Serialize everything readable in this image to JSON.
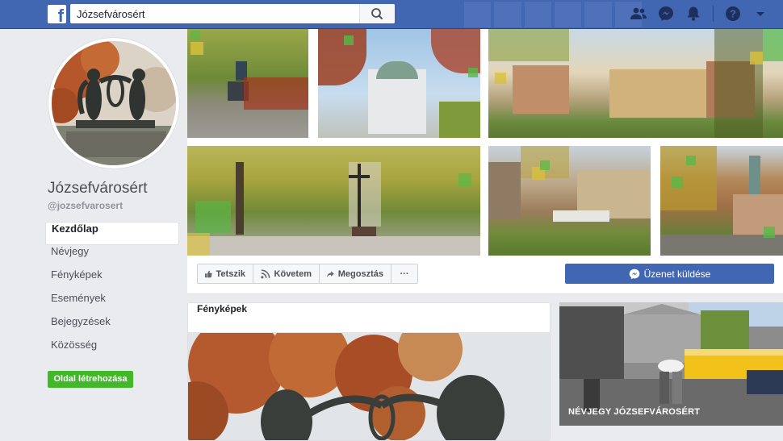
{
  "topbar": {
    "logo": "f",
    "search_value": "Józsefvárosért",
    "icons": [
      "friends-icon",
      "messenger-icon",
      "bell-icon",
      "help-icon",
      "dropdown-icon"
    ]
  },
  "page": {
    "name": "Józsefvárosért",
    "handle": "@jozsefvarosert"
  },
  "nav": {
    "items": [
      "Kezdőlap",
      "Névjegy",
      "Fényképek",
      "Események",
      "Bejegyzések",
      "Közösség"
    ],
    "active": "Kezdőlap",
    "create_page": "Oldal létrehozása"
  },
  "actions": {
    "like": "Tetszik",
    "follow": "Követem",
    "share": "Megosztás",
    "more": "···",
    "message": "Üzenet küldése"
  },
  "photos": {
    "title": "Fényképek"
  },
  "about": {
    "label": "NÉVJEGY JÓZSEFVÁROSÉRT"
  },
  "colors": {
    "fb_blue": "#4267b2",
    "green_button": "#42b72a",
    "background": "#e9ebee"
  }
}
